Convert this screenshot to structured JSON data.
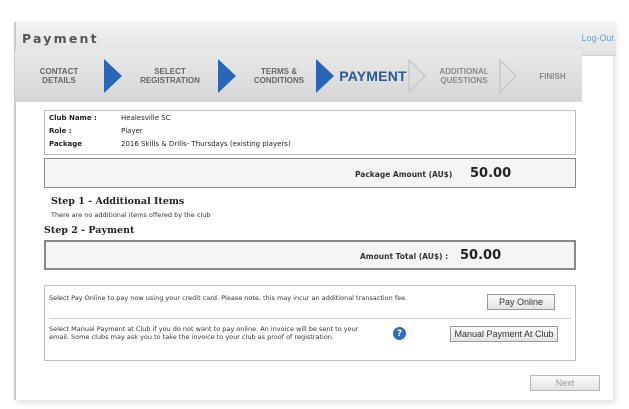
{
  "header": {
    "title": "Payment",
    "logout": "Log-Out"
  },
  "wizard": {
    "steps": [
      {
        "label": "CONTACT\nDETAILS",
        "state": "done"
      },
      {
        "label": "SELECT\nREGISTRATION",
        "state": "done"
      },
      {
        "label": "TERMS &\nCONDITIONS",
        "state": "done"
      },
      {
        "label": "PAYMENT",
        "state": "active"
      },
      {
        "label": "ADDITIONAL\nQUESTIONS",
        "state": "future"
      },
      {
        "label": "FINISH",
        "state": "future"
      }
    ],
    "colors": {
      "done_arrow": "#2a66b8",
      "future_arrow": "#c8c8c8"
    }
  },
  "details": {
    "club_label": "Club Name :",
    "club_value": "Healesville SC",
    "role_label": "Role :",
    "role_value": "Player",
    "package_label": "Package",
    "package_value": "2016 Skills & Drills- Thursdays (existing players)"
  },
  "package_amount": {
    "label": "Package Amount (AU$)",
    "value": "50.00"
  },
  "step1": {
    "heading": "Step 1 - Additional Items",
    "note": "There are no additional items offered by the club"
  },
  "step2": {
    "heading": "Step 2 - Payment"
  },
  "amount_total": {
    "label": "Amount Total (AU$) :",
    "value": "50.00"
  },
  "payment_options": {
    "online_text": "Select Pay Online to pay now using your credit card. Please note, this may incur an additional transaction fee.",
    "online_button": "Pay Online",
    "manual_text": "Select Manual Payment at Club if you do not want to pay online. An invoice will be sent to your email. Some clubs may ask you to take the invoice to your club as proof of registration.",
    "manual_button": "Manual Payment At Club",
    "help_icon": "?"
  },
  "footer": {
    "next_button": "Next"
  }
}
